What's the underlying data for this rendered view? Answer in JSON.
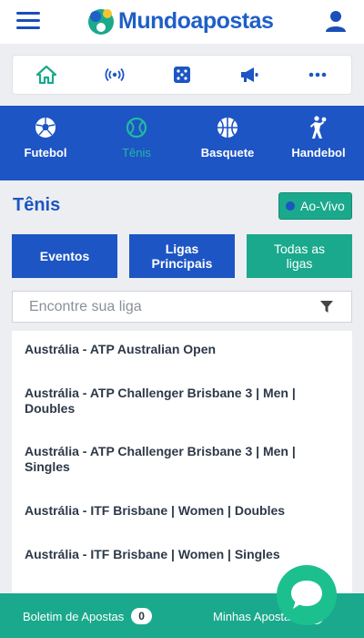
{
  "header": {
    "logo_text": "Mundoapostas",
    "menu_icon": "hamburger-icon",
    "user_icon": "user-icon"
  },
  "quicknav": {
    "items": [
      {
        "icon": "home-icon"
      },
      {
        "icon": "live-broadcast-icon"
      },
      {
        "icon": "dice-icon"
      },
      {
        "icon": "megaphone-icon"
      },
      {
        "icon": "more-dots-icon"
      }
    ]
  },
  "sports": [
    {
      "label": "Futebol",
      "icon": "soccer-ball-icon",
      "active": false
    },
    {
      "label": "Tênis",
      "icon": "tennis-ball-icon",
      "active": true
    },
    {
      "label": "Basquete",
      "icon": "basketball-icon",
      "active": false
    },
    {
      "label": "Handebol",
      "icon": "handball-player-icon",
      "active": false
    }
  ],
  "page": {
    "title": "Tênis",
    "live_label": "Ao-Vivo"
  },
  "tabs": {
    "eventos": "Eventos",
    "ligas_line1": "Ligas",
    "ligas_line2": "Principais",
    "todas_line1": "Todas as",
    "todas_line2": "ligas"
  },
  "search": {
    "placeholder": "Encontre sua liga",
    "value": ""
  },
  "leagues": [
    {
      "line1": "Austrália - ATP Australian Open",
      "line2": ""
    },
    {
      "line1": "Austrália - ATP Challenger Brisbane 3 | Men |",
      "line2": "Doubles"
    },
    {
      "line1": "Austrália - ATP Challenger Brisbane 3 | Men |",
      "line2": "Singles"
    },
    {
      "line1": "Austrália - ITF Brisbane | Women | Doubles",
      "line2": ""
    },
    {
      "line1": "Austrália - ITF Brisbane | Women | Singles",
      "line2": ""
    }
  ],
  "footer": {
    "boletim_label": "Boletim de Apostas",
    "boletim_count": "0",
    "minhas_label": "Minhas Apostas",
    "minhas_count": "0"
  },
  "colors": {
    "brand_blue": "#1d55c4",
    "brand_green": "#1aa98c",
    "chat_green": "#1cc08e"
  }
}
